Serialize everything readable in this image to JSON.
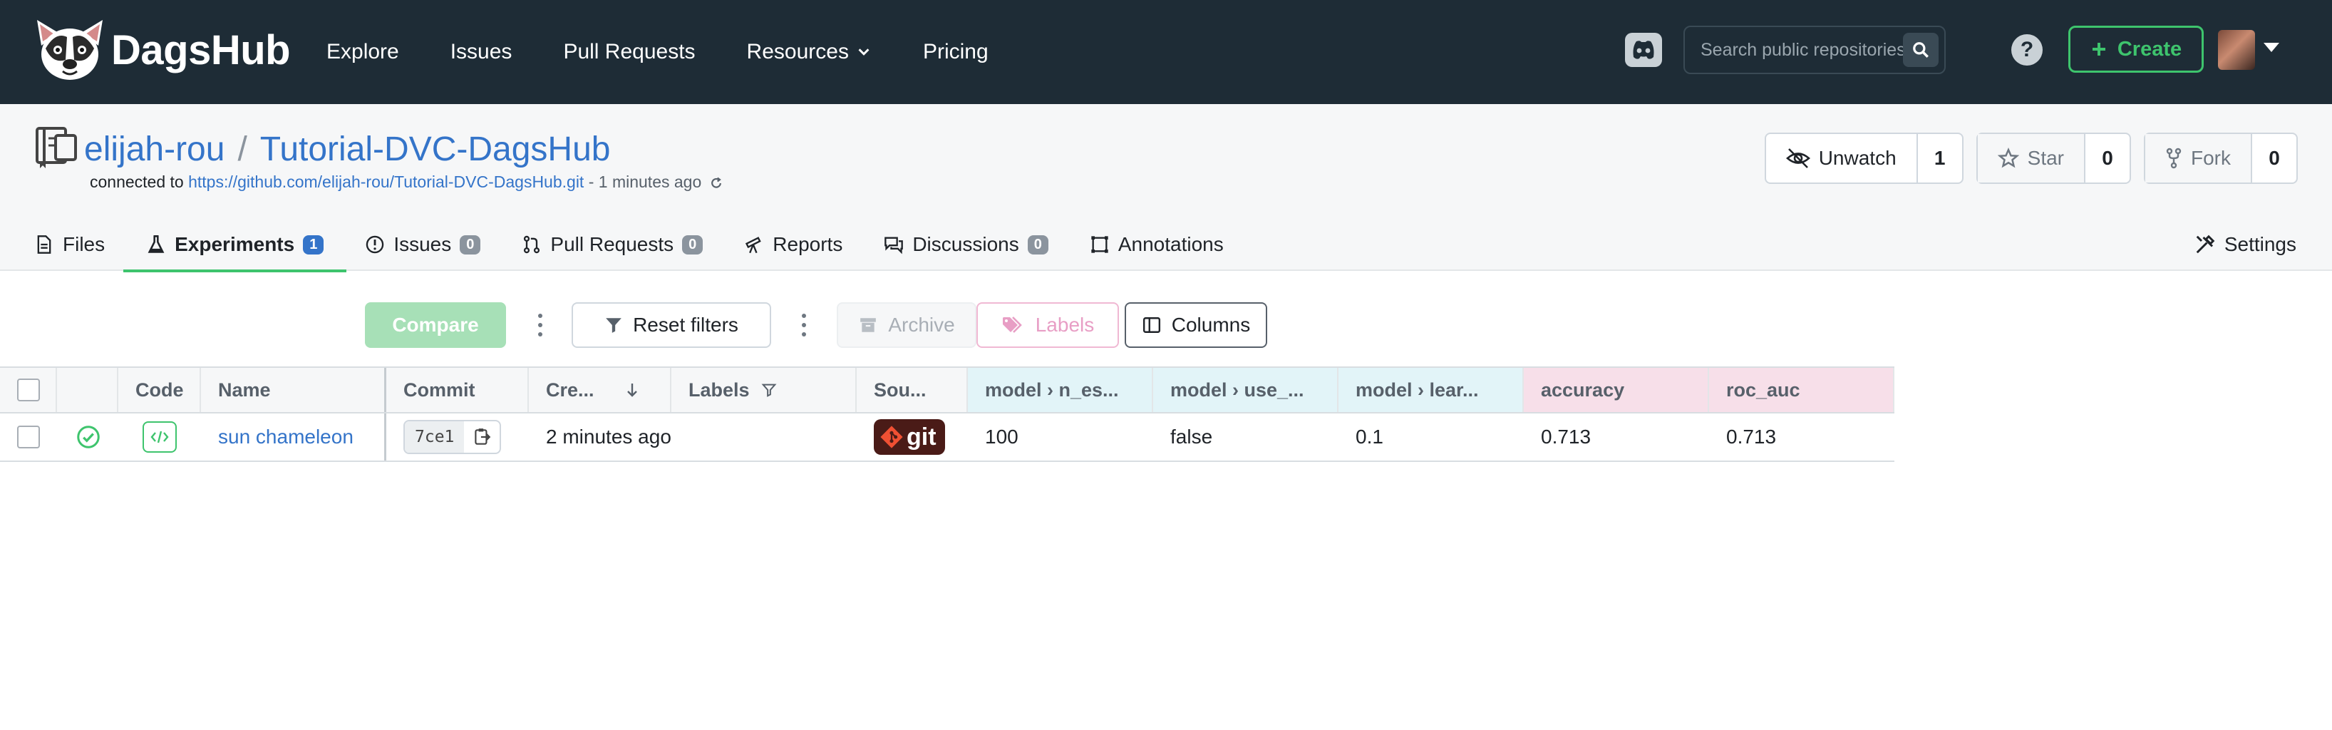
{
  "nav": {
    "brand": "DagsHub",
    "links": [
      {
        "label": "Explore"
      },
      {
        "label": "Issues"
      },
      {
        "label": "Pull Requests"
      },
      {
        "label": "Resources",
        "has_dropdown": true
      },
      {
        "label": "Pricing"
      }
    ],
    "search_placeholder": "Search public repositories...",
    "help": "?",
    "create_label": "Create"
  },
  "repo": {
    "owner": "elijah-rou",
    "separator": "/",
    "name": "Tutorial-DVC-DagsHub",
    "connected_prefix": "connected to",
    "connected_url": "https://github.com/elijah-rou/Tutorial-DVC-DagsHub.git",
    "connected_ago": "- 1 minutes ago",
    "actions": {
      "unwatch_label": "Unwatch",
      "unwatch_count": "1",
      "star_label": "Star",
      "star_count": "0",
      "fork_label": "Fork",
      "fork_count": "0"
    }
  },
  "tabs": [
    {
      "label": "Files",
      "icon": "file-icon"
    },
    {
      "label": "Experiments",
      "icon": "flask-icon",
      "badge": "1",
      "active": true
    },
    {
      "label": "Issues",
      "icon": "alert-circle-icon",
      "badge": "0"
    },
    {
      "label": "Pull Requests",
      "icon": "pull-request-icon",
      "badge": "0"
    },
    {
      "label": "Reports",
      "icon": "telescope-icon"
    },
    {
      "label": "Discussions",
      "icon": "chat-icon",
      "badge": "0"
    },
    {
      "label": "Annotations",
      "icon": "bounding-box-icon"
    }
  ],
  "settings_label": "Settings",
  "toolbar": {
    "compare": "Compare",
    "reset_filters": "Reset filters",
    "archive": "Archive",
    "labels": "Labels",
    "columns": "Columns"
  },
  "table": {
    "headers": {
      "code": "Code",
      "name": "Name",
      "commit": "Commit",
      "created": "Cre...",
      "labels": "Labels",
      "source": "Sou...",
      "p1": "model › n_es...",
      "p2": "model › use_...",
      "p3": "model › lear...",
      "m1": "accuracy",
      "m2": "roc_auc"
    },
    "rows": [
      {
        "name": "sun chameleon",
        "commit": "7ce1",
        "created": "2 minutes ago",
        "source": "git",
        "p1": "100",
        "p2": "false",
        "p3": "0.1",
        "m1": "0.713",
        "m2": "0.713"
      }
    ]
  },
  "colors": {
    "nav_bg": "#1e2c36",
    "accent_green": "#3ec46d",
    "link_blue": "#3474c9",
    "params_header_bg": "#e2f4f8",
    "metrics_header_bg": "#f7dfe9"
  }
}
